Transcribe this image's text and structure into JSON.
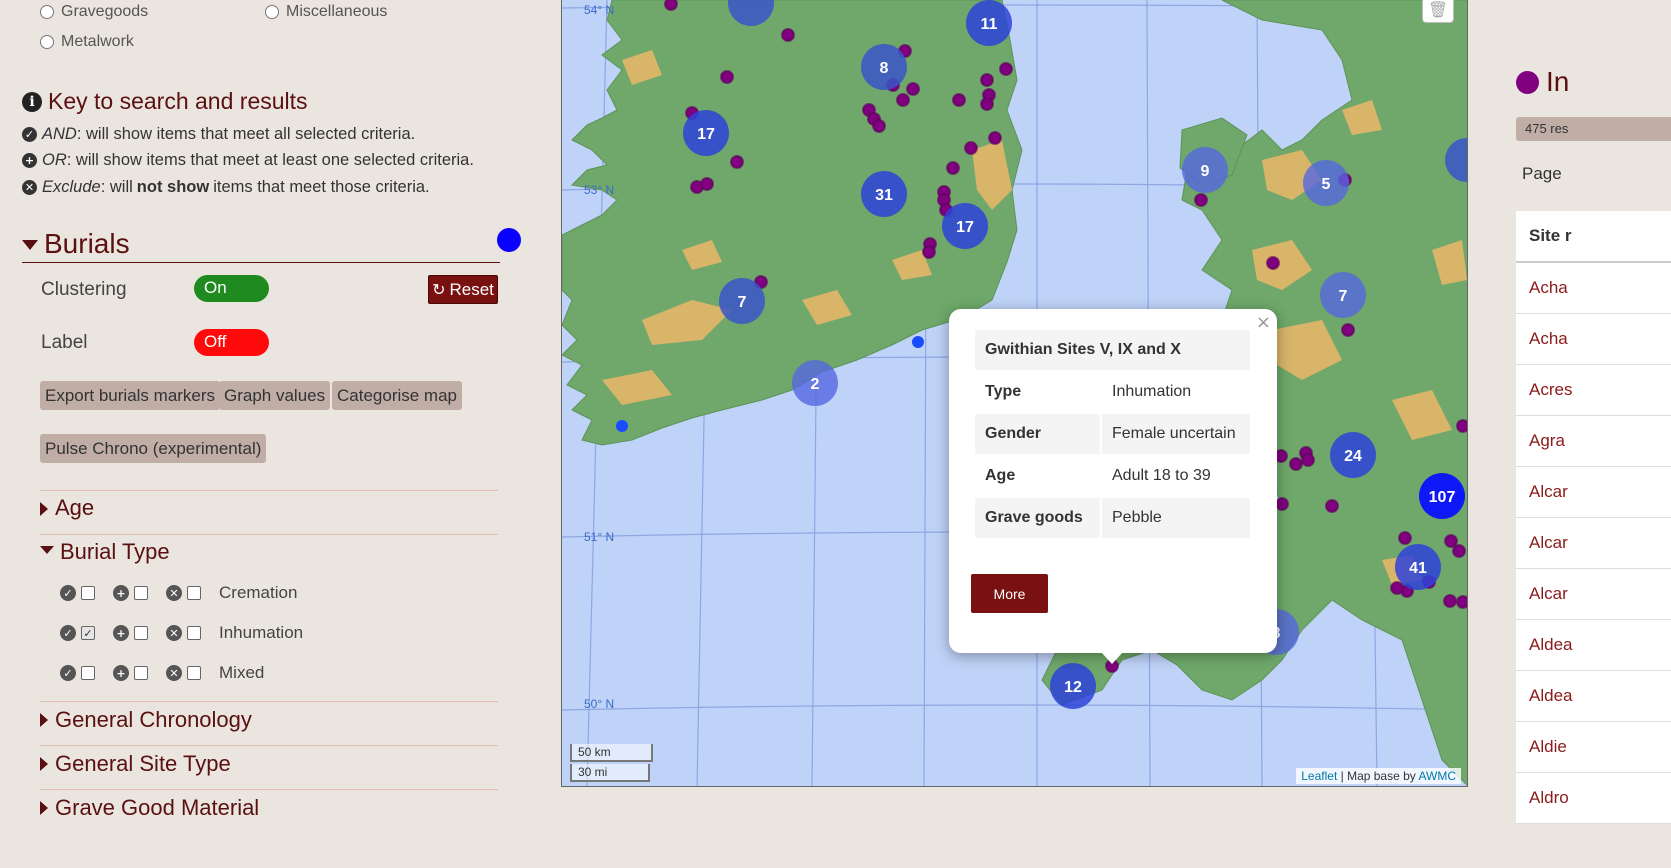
{
  "filters_top": {
    "gravegoods": "Gravegoods",
    "miscellaneous": "Miscellaneous",
    "metalwork": "Metalwork"
  },
  "key": {
    "title": "Key to search and results",
    "and_kw": "AND",
    "and_text": ": will show items that meet all selected criteria.",
    "or_kw": "OR",
    "or_text": ": will show items that meet at least one selected criteria.",
    "exclude_kw": "Exclude",
    "exclude_mid": ": will",
    "exclude_bold": "not show",
    "exclude_text": "items that meet those criteria."
  },
  "burials": {
    "title": "Burials",
    "dot_color": "#0a00ff",
    "clustering_label": "Clustering",
    "clustering_state": "On",
    "label_label": "Label",
    "label_state": "Off",
    "reset_label": "Reset",
    "buttons": [
      "Export burials markers",
      "Graph values",
      "Categorise map",
      "Pulse Chrono (experimental)"
    ]
  },
  "accordions": {
    "age": "Age",
    "burial_type": "Burial Type",
    "general_chronology": "General Chronology",
    "general_site_type": "General Site Type",
    "grave_good_material": "Grave Good Material"
  },
  "burial_types": [
    {
      "label": "Cremation",
      "and": false,
      "or": false,
      "exclude": false
    },
    {
      "label": "Inhumation",
      "and": true,
      "or": false,
      "exclude": false
    },
    {
      "label": "Mixed",
      "and": false,
      "or": false,
      "exclude": false
    }
  ],
  "map": {
    "latitudes": [
      "54° N",
      "53° N",
      "51° N",
      "50° N"
    ],
    "clusters": [
      {
        "label": "11"
      },
      {
        "label": "8"
      },
      {
        "label": "17"
      },
      {
        "label": "31"
      },
      {
        "label": "17"
      },
      {
        "label": "9"
      },
      {
        "label": "5"
      },
      {
        "label": "7"
      },
      {
        "label": "7"
      },
      {
        "label": "2"
      },
      {
        "label": "24"
      },
      {
        "label": "107"
      },
      {
        "label": "41"
      },
      {
        "label": "8"
      },
      {
        "label": "12"
      }
    ],
    "scale_km": "50 km",
    "scale_mi": "30 mi",
    "attribution_leaflet": "Leaflet",
    "attribution_sep": " | Map base by ",
    "attribution_awmc": "AWMC",
    "close_glyph": "×",
    "colors": {
      "sea": "#bfd3f8",
      "land": "#6fa86a",
      "highland": "#d9b56a",
      "marker": "#800080",
      "cluster": "#3346d6"
    }
  },
  "popup": {
    "site": "Gwithian Sites V, IX and X",
    "rows": [
      {
        "key": "Type",
        "value": "Inhumation"
      },
      {
        "key": "Gender",
        "value": "Female uncertain"
      },
      {
        "key": "Age",
        "value": "Adult 18 to 39"
      },
      {
        "key": "Grave goods",
        "value": "Pebble"
      }
    ],
    "more": "More"
  },
  "results": {
    "title": "In",
    "count": "475 res",
    "page": "Page",
    "header": "Site r",
    "rows": [
      "Acha",
      "Acha",
      "Acres",
      "Agra",
      "Alcar",
      "Alcar",
      "Alcar",
      "Aldea",
      "Aldea",
      "Aldie",
      "Aldro"
    ]
  }
}
